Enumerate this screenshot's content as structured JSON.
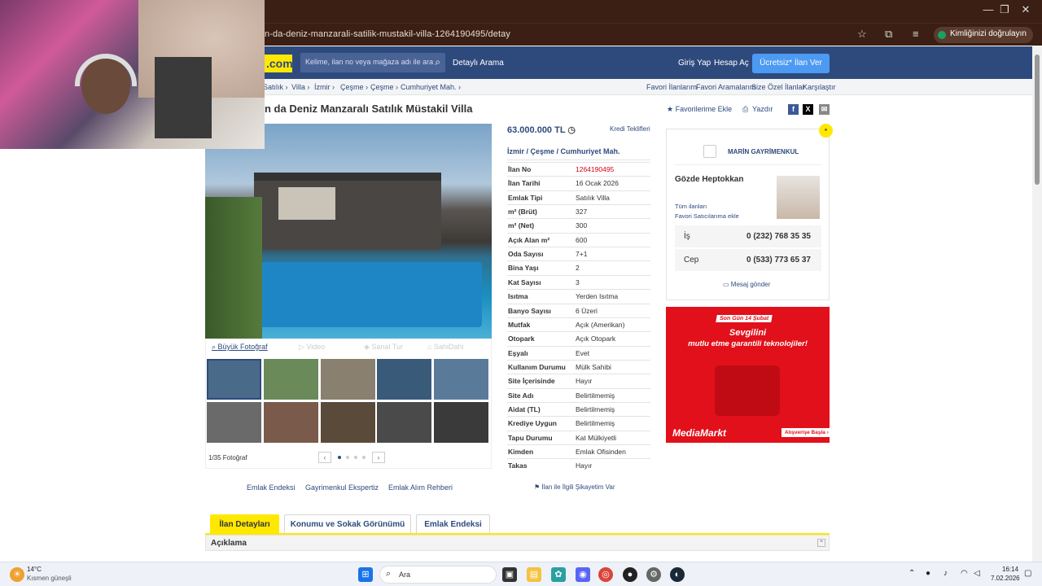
{
  "browser": {
    "url": "n-da-deniz-manzarali-satilik-mustakil-villa-1264190495/detay",
    "verify_label": "Kimliğinizi doğrulayın",
    "controls": [
      "—",
      "❐",
      "✕"
    ]
  },
  "header": {
    "logo": ".com",
    "search_placeholder": "Kelime, ilan no veya mağaza adı ile ara",
    "detailed_search": "Detaylı Arama",
    "login": "Giriş Yap",
    "signup": "Hesap Aç",
    "cta": "Ücretsiz* İlan Ver"
  },
  "breadcrumb": [
    "Satılık ›",
    "Villa ›",
    "İzmir ›",
    "Çeşme ›",
    "Çeşme ›",
    "Cumhuriyet Mah. ›"
  ],
  "top_links": [
    "Favori İlanlarım",
    "Favori Aramalarım",
    "Size Özel İlanlar",
    "Karşılaştır"
  ],
  "listing": {
    "title": "n da Deniz Manzaralı Satılık Müstakil Villa",
    "fav": "★ Favorilerime Ekle",
    "print": "Yazdır",
    "price": "63.000.000 TL",
    "kredi": "Kredi Teklifleri",
    "location": "İzmir  /  Çeşme  /  Cumhuriyet Mah.",
    "details": [
      {
        "k": "İlan No",
        "v": "1264190495",
        "red": true
      },
      {
        "k": "İlan Tarihi",
        "v": "16 Ocak 2026"
      },
      {
        "k": "Emlak Tipi",
        "v": "Satılık Villa"
      },
      {
        "k": "m² (Brüt)",
        "v": "327"
      },
      {
        "k": "m² (Net)",
        "v": "300"
      },
      {
        "k": "Açık Alan m²",
        "v": "600"
      },
      {
        "k": "Oda Sayısı",
        "v": "7+1"
      },
      {
        "k": "Bina Yaşı",
        "v": "2"
      },
      {
        "k": "Kat Sayısı",
        "v": "3"
      },
      {
        "k": "Isıtma",
        "v": "Yerden Isıtma"
      },
      {
        "k": "Banyo Sayısı",
        "v": "6 Üzeri"
      },
      {
        "k": "Mutfak",
        "v": "Açık (Amerikan)"
      },
      {
        "k": "Otopark",
        "v": "Açık Otopark"
      },
      {
        "k": "Eşyalı",
        "v": "Evet"
      },
      {
        "k": "Kullanım Durumu",
        "v": "Mülk Sahibi"
      },
      {
        "k": "Site İçerisinde",
        "v": "Hayır"
      },
      {
        "k": "Site Adı",
        "v": "Belirtilmemiş"
      },
      {
        "k": "Aidat (TL)",
        "v": "Belirtilmemiş"
      },
      {
        "k": "Krediye Uygun",
        "v": "Belirtilmemiş"
      },
      {
        "k": "Tapu Durumu",
        "v": "Kat Mülkiyetli"
      },
      {
        "k": "Kimden",
        "v": "Emlak Ofisinden"
      },
      {
        "k": "Takas",
        "v": "Hayır"
      }
    ],
    "complaint": "İlan ile İlgili Şikayetim Var"
  },
  "gallery": {
    "big_photo": "Büyük Fotoğraf",
    "video": "Video",
    "tour": "Sanal Tur",
    "owner": "SahiDahi",
    "count": "1/35 Fotoğraf",
    "thumb_colors": [
      "#4a6a8a",
      "#6a8a5a",
      "#8a8070",
      "#3a5a7a",
      "#5a7a9a",
      "#6a6a6a",
      "#7a5a4a",
      "#5a4a3a",
      "#4a4a4a",
      "#3a3a3a"
    ]
  },
  "seller": {
    "company": "MARİN GAYRİMENKUL",
    "agent": "Gözde Heptokkan",
    "all_listings": "Tüm ilanları",
    "fav_seller": "Favori Satıcılarıma ekle",
    "work_label": "İş",
    "work_phone": "0 (232) 768 35 35",
    "mobile_label": "Cep",
    "mobile_phone": "0 (533) 773 65 37",
    "message": "Mesaj gönder"
  },
  "ad": {
    "tag": "Son Gün 14 Şubat",
    "line1": "Sevgilini",
    "line2": "mutlu etme garantili teknolojiler!",
    "brand": "MediaMarkt",
    "button": "Alışverişe Başla ›"
  },
  "footer_links": [
    "Emlak Endeksi",
    "Gayrimenkul Ekspertiz",
    "Emlak Alım Rehberi"
  ],
  "tabs": [
    "İlan Detayları",
    "Konumu ve Sokak Görünümü",
    "Emlak Endeksi"
  ],
  "desc_title": "Açıklama",
  "taskbar": {
    "weather_temp": "14°C",
    "weather_desc": "Kısmen güneşli",
    "search": "Ara",
    "time": "16:14",
    "date": "7.02.2026"
  }
}
